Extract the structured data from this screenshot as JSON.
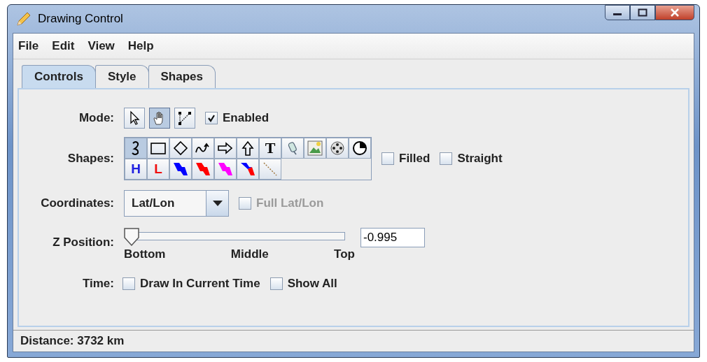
{
  "window": {
    "title": "Drawing Control"
  },
  "menu": [
    {
      "label": "File"
    },
    {
      "label": "Edit"
    },
    {
      "label": "View"
    },
    {
      "label": "Help"
    }
  ],
  "tabs": [
    {
      "label": "Controls",
      "selected": true
    },
    {
      "label": "Style",
      "selected": false
    },
    {
      "label": "Shapes",
      "selected": false
    }
  ],
  "mode": {
    "label": "Mode:",
    "tools": [
      {
        "kind": "select",
        "selected": false
      },
      {
        "kind": "pan",
        "selected": true
      },
      {
        "kind": "edit",
        "selected": false
      }
    ],
    "enabled": {
      "label": "Enabled",
      "checked": true
    }
  },
  "shapes": {
    "label": "Shapes:",
    "rows": [
      [
        {
          "kind": "freehand",
          "selected": true
        },
        {
          "kind": "rectangle",
          "selected": false
        },
        {
          "kind": "diamond",
          "selected": false
        },
        {
          "kind": "curve",
          "selected": false
        },
        {
          "kind": "right-arrow",
          "selected": false
        },
        {
          "kind": "up-arrow",
          "selected": false
        },
        {
          "kind": "text",
          "label": "T",
          "selected": false
        },
        {
          "kind": "placemark",
          "selected": false
        },
        {
          "kind": "image",
          "selected": false
        },
        {
          "kind": "wheel",
          "selected": false
        },
        {
          "kind": "pie",
          "selected": false
        }
      ],
      [
        {
          "kind": "letter",
          "label": "H",
          "color": "#2020e0",
          "selected": false
        },
        {
          "kind": "letter",
          "label": "L",
          "color": "#f01010",
          "selected": false
        },
        {
          "kind": "front",
          "color": "#0000ff",
          "selected": false
        },
        {
          "kind": "front",
          "color": "#ff0000",
          "selected": false
        },
        {
          "kind": "front",
          "color": "#ff00ff",
          "selected": false
        },
        {
          "kind": "stationary",
          "selected": false
        },
        {
          "kind": "dashed-line",
          "selected": false
        }
      ]
    ],
    "filled": {
      "label": "Filled",
      "checked": false
    },
    "straight": {
      "label": "Straight",
      "checked": false
    }
  },
  "coordinates": {
    "label": "Coordinates:",
    "value": "Lat/Lon",
    "full": {
      "label": "Full Lat/Lon",
      "checked": false,
      "disabled": true
    }
  },
  "z_position": {
    "label": "Z Position:",
    "level": 0.0,
    "value": "-0.995",
    "ticks": [
      "Bottom",
      "Middle",
      "Top"
    ]
  },
  "time": {
    "label": "Time:",
    "draw_current": {
      "label": "Draw In Current Time",
      "checked": false
    },
    "show_all": {
      "label": "Show All",
      "checked": false
    }
  },
  "status_bar": {
    "text": "Distance: 3732 km"
  }
}
